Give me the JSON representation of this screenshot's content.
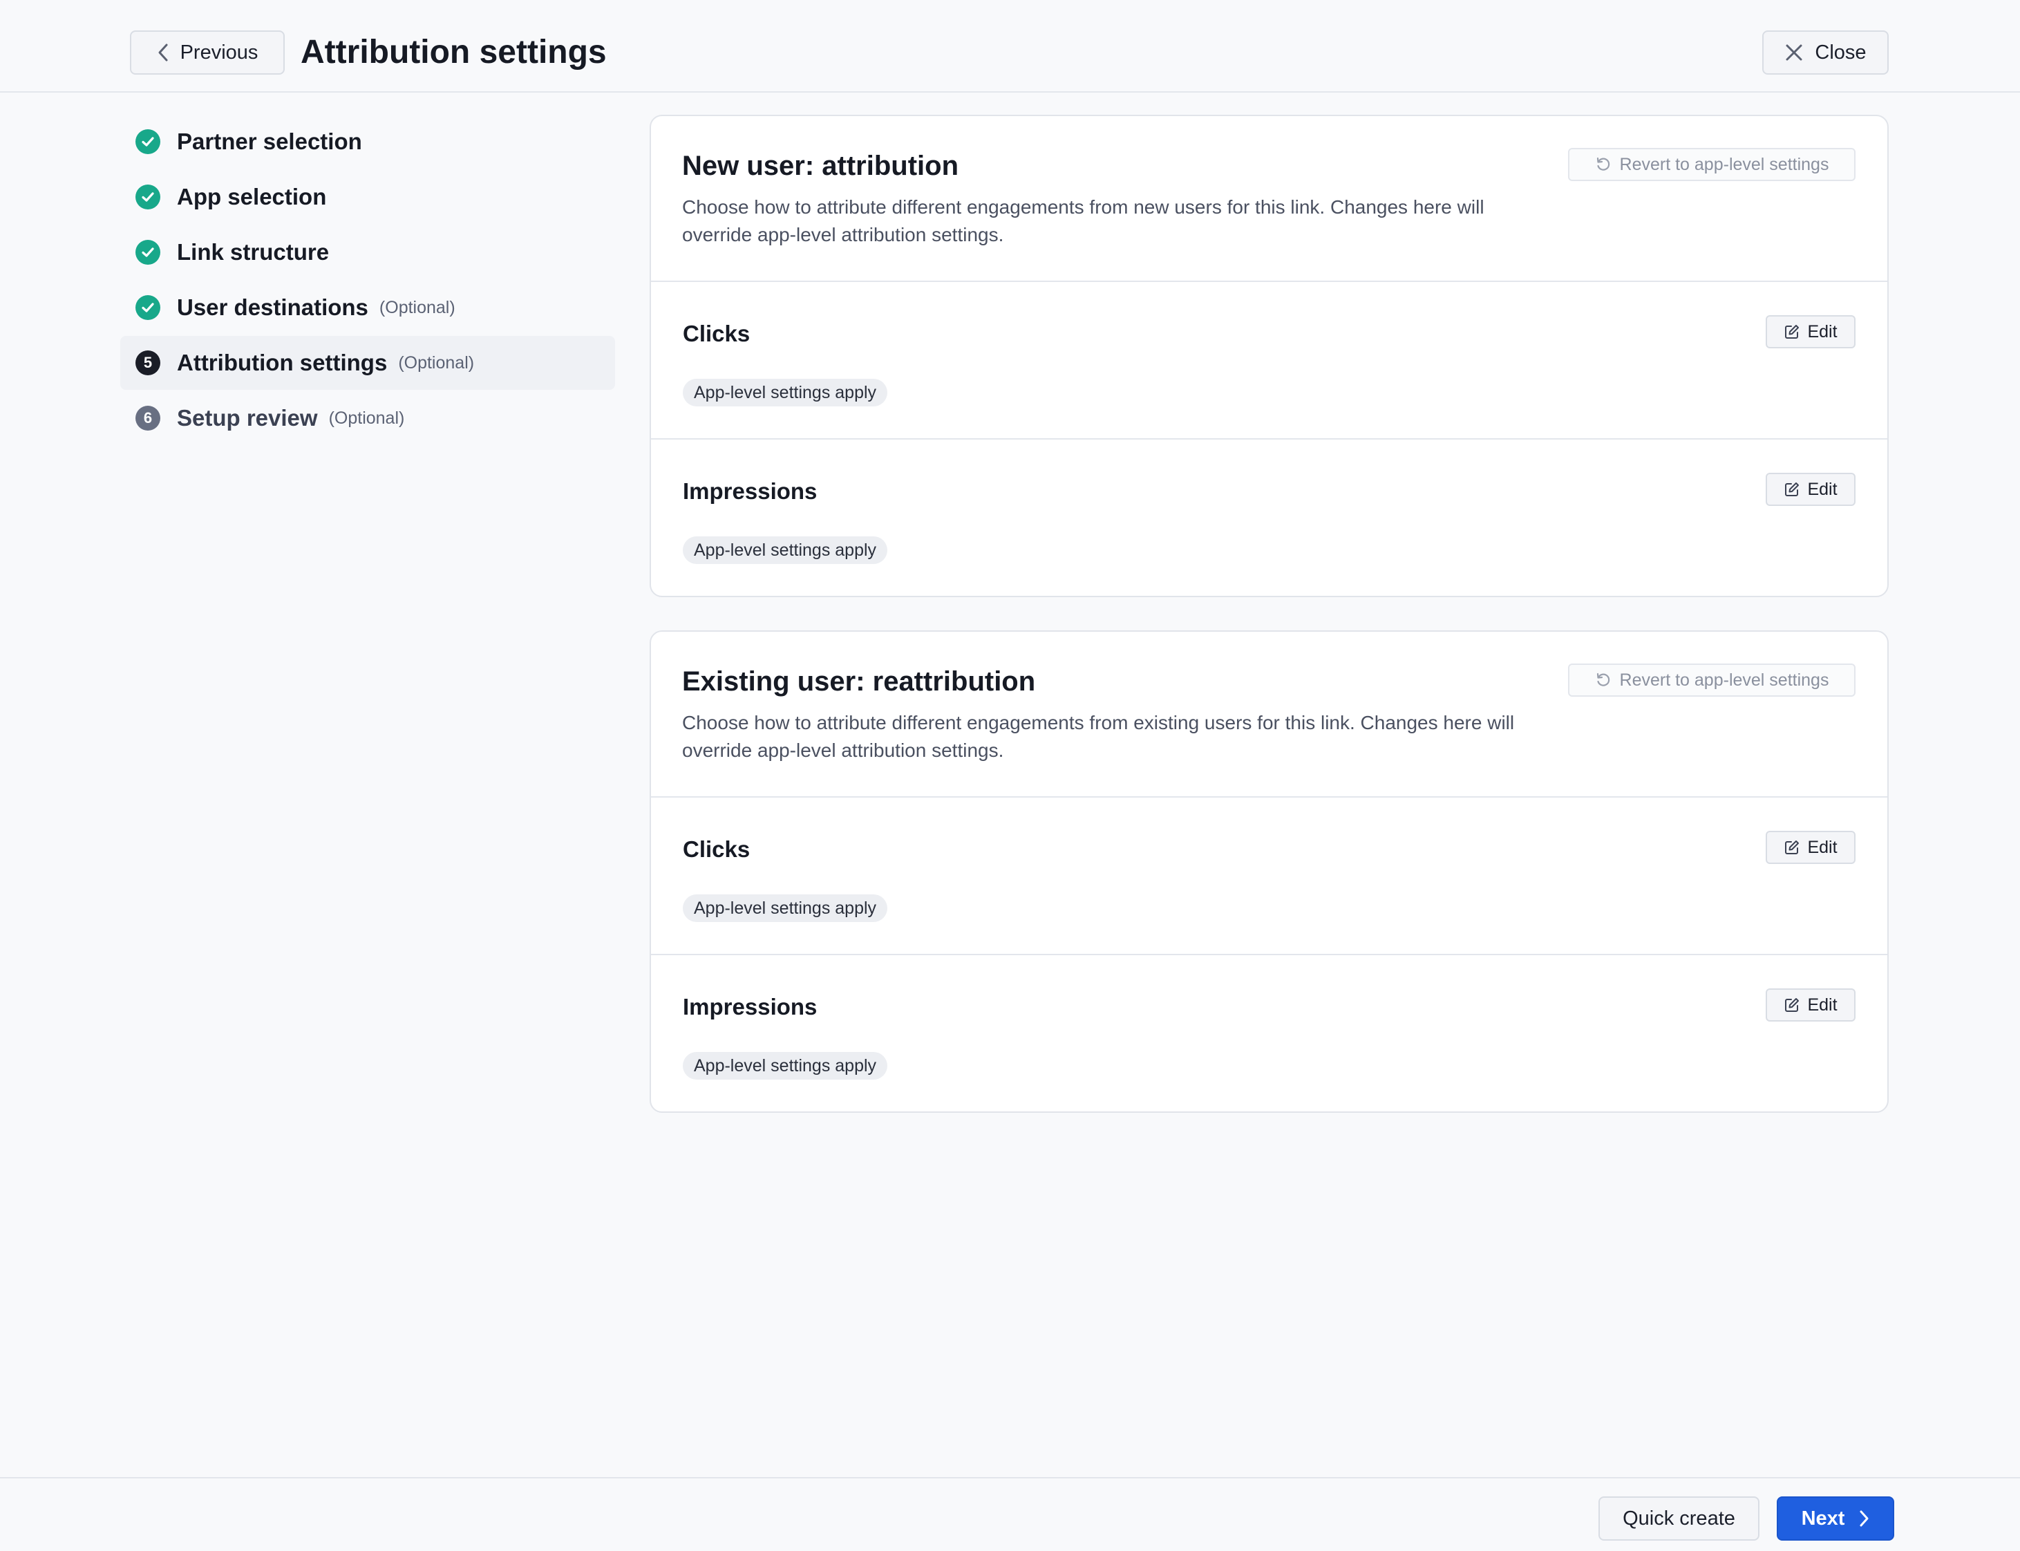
{
  "header": {
    "previous_label": "Previous",
    "title": "Attribution settings",
    "close_label": "Close"
  },
  "steps": [
    {
      "label": "Partner selection",
      "optional": "",
      "state": "done"
    },
    {
      "label": "App selection",
      "optional": "",
      "state": "done"
    },
    {
      "label": "Link structure",
      "optional": "",
      "state": "done"
    },
    {
      "label": "User destinations",
      "optional": "(Optional)",
      "state": "done"
    },
    {
      "number": "5",
      "label": "Attribution settings",
      "optional": "(Optional)",
      "state": "current"
    },
    {
      "number": "6",
      "label": "Setup review",
      "optional": "(Optional)",
      "state": "pending"
    }
  ],
  "cards": [
    {
      "title": "New user: attribution",
      "description": "Choose how to attribute different engagements from new users for this link. Changes here will override app-level attribution settings.",
      "revert_label": "Revert to app-level settings",
      "sections": [
        {
          "title": "Clicks",
          "edit_label": "Edit",
          "badge": "App-level settings apply"
        },
        {
          "title": "Impressions",
          "edit_label": "Edit",
          "badge": "App-level settings apply"
        }
      ]
    },
    {
      "title": "Existing user: reattribution",
      "description": "Choose how to attribute different engagements from existing users for this link. Changes here will override app-level attribution settings.",
      "revert_label": "Revert to app-level settings",
      "sections": [
        {
          "title": "Clicks",
          "edit_label": "Edit",
          "badge": "App-level settings apply"
        },
        {
          "title": "Impressions",
          "edit_label": "Edit",
          "badge": "App-level settings apply"
        }
      ]
    }
  ],
  "footer": {
    "quick_create_label": "Quick create",
    "next_label": "Next"
  },
  "colors": {
    "accent": "#1f5fe0",
    "done": "#18a88a",
    "background": "#f8f9fb"
  }
}
